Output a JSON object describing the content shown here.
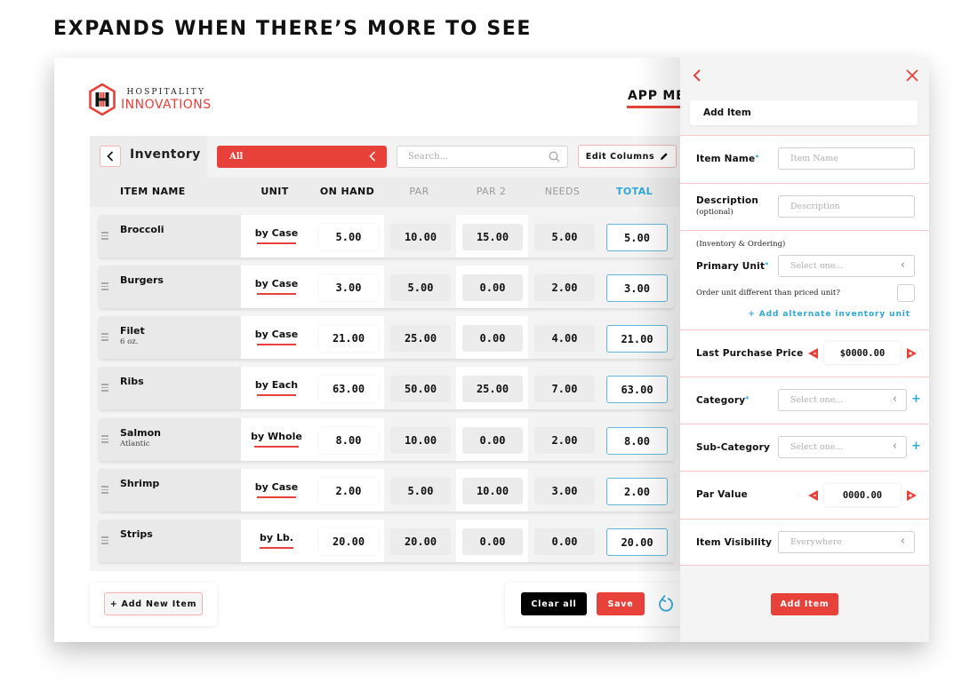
{
  "headline": "EXPANDS WHEN THERE’S MORE TO SEE",
  "brand": {
    "top": "HOSPITALITY",
    "bottom": "INNOVATIONS",
    "logo_icon": "hexagon-hh-logo-icon"
  },
  "nav": {
    "app_menu": "APP MENU"
  },
  "toolbar": {
    "back_icon": "chevron-left-icon",
    "title": "Inventory",
    "filter_value": "All",
    "filter_icon": "chevron-left-icon",
    "search_placeholder": "Search...",
    "search_icon": "search-icon",
    "edit_columns_label": "Edit Columns",
    "edit_icon": "pencil-icon"
  },
  "table": {
    "columns": [
      "ITEM NAME",
      "UNIT",
      "ON HAND",
      "PAR",
      "PAR 2",
      "NEEDS",
      "TOTAL"
    ],
    "rows": [
      {
        "name": "Broccoli",
        "sub": "",
        "unit": "by Case",
        "on_hand": "5.00",
        "par": "10.00",
        "par2": "15.00",
        "needs": "5.00",
        "total": "5.00"
      },
      {
        "name": "Burgers",
        "sub": "",
        "unit": "by Case",
        "on_hand": "3.00",
        "par": "5.00",
        "par2": "0.00",
        "needs": "2.00",
        "total": "3.00"
      },
      {
        "name": "Filet",
        "sub": "6 oz.",
        "unit": "by Case",
        "on_hand": "21.00",
        "par": "25.00",
        "par2": "0.00",
        "needs": "4.00",
        "total": "21.00"
      },
      {
        "name": "Ribs",
        "sub": "",
        "unit": "by Each",
        "on_hand": "63.00",
        "par": "50.00",
        "par2": "25.00",
        "needs": "7.00",
        "total": "63.00"
      },
      {
        "name": "Salmon",
        "sub": "Atlantic",
        "unit": "by Whole",
        "on_hand": "8.00",
        "par": "10.00",
        "par2": "0.00",
        "needs": "2.00",
        "total": "8.00"
      },
      {
        "name": "Shrimp",
        "sub": "",
        "unit": "by Case",
        "on_hand": "2.00",
        "par": "5.00",
        "par2": "10.00",
        "needs": "3.00",
        "total": "2.00"
      },
      {
        "name": "Strips",
        "sub": "",
        "unit": "by Lb.",
        "on_hand": "20.00",
        "par": "20.00",
        "par2": "0.00",
        "needs": "0.00",
        "total": "20.00"
      }
    ]
  },
  "footer": {
    "add_new_item": "+ Add New Item",
    "clear_all": "Clear all",
    "save": "Save",
    "undo_icon": "undo-icon"
  },
  "panel": {
    "back_icon": "chevron-left-icon",
    "close_icon": "close-icon",
    "title": "Add Item",
    "item_name_label": "Item Name",
    "item_name_placeholder": "Item Name",
    "description_label": "Description",
    "description_sub": "(optional)",
    "description_placeholder": "Description",
    "unit_section_note": "(Inventory & Ordering)",
    "primary_unit_label": "Primary Unit",
    "primary_unit_value": "Select one...",
    "order_unit_question": "Order unit different than priced unit?",
    "order_unit_checked": false,
    "alt_unit_link": "+ Add alternate inventory unit",
    "last_price_label": "Last Purchase Price",
    "last_price_value": "$0000.00",
    "category_label": "Category",
    "category_value": "Select one...",
    "subcategory_label": "Sub-Category",
    "subcategory_value": "Select one...",
    "par_label": "Par Value",
    "par_value": "0000.00",
    "visibility_label": "Item Visibility",
    "visibility_value": "Everywhere",
    "required_mark": "*",
    "plus": "+",
    "add_button": "Add Item"
  },
  "colors": {
    "accent_red": "#e8413a",
    "accent_blue": "#2fa8d8",
    "total_border": "#62b8d8"
  }
}
